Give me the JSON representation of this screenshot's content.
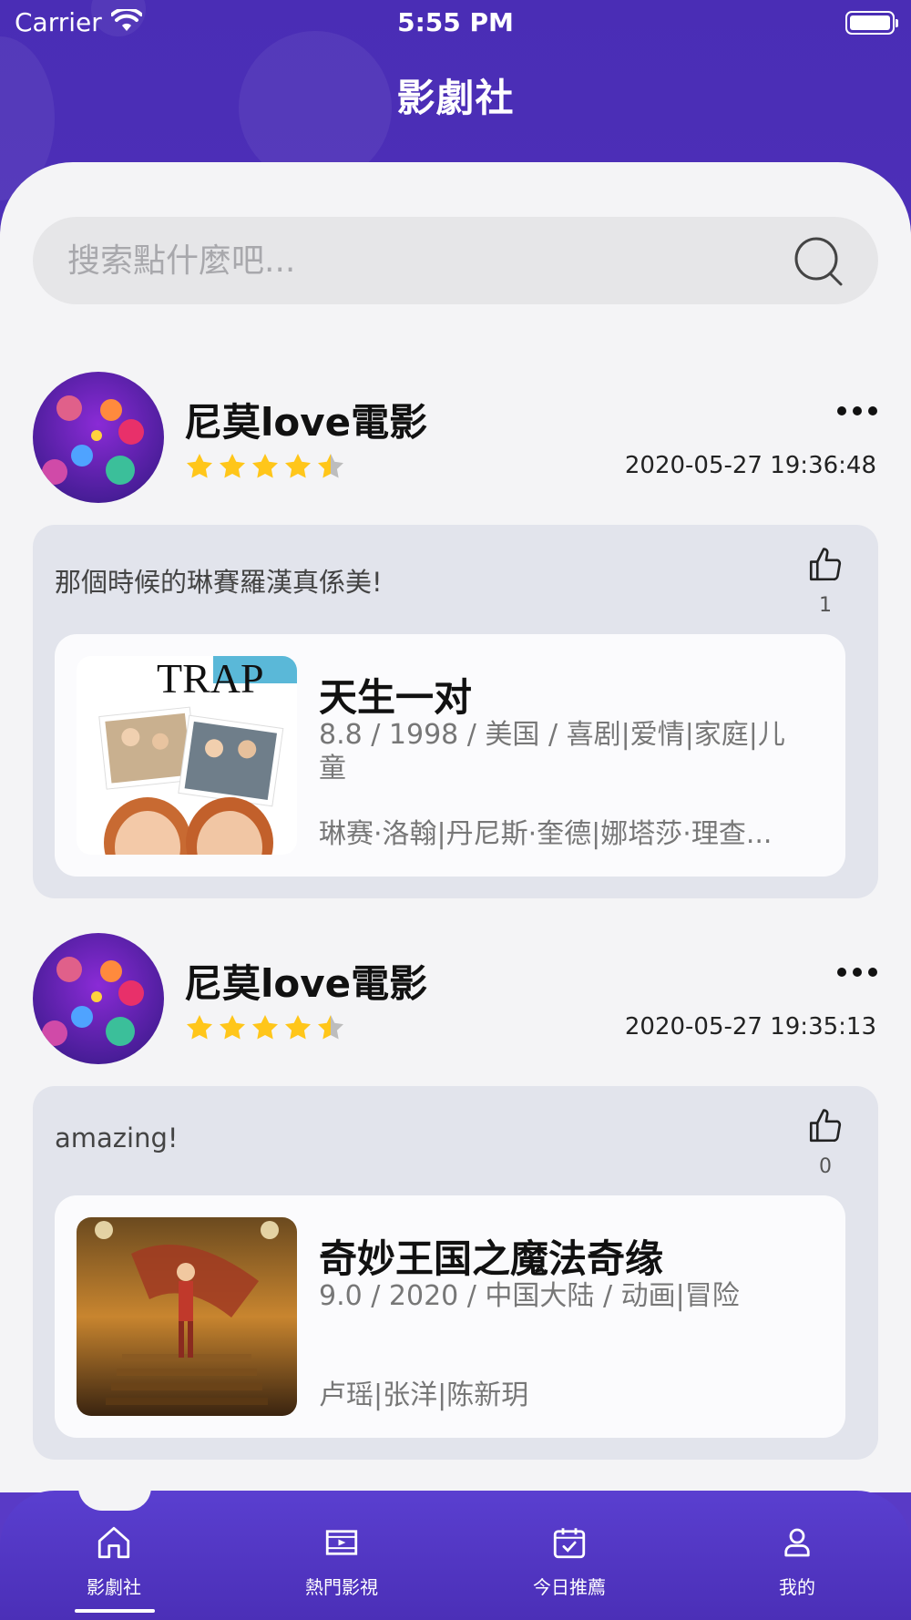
{
  "status_bar": {
    "carrier": "Carrier",
    "time": "5:55 PM"
  },
  "header": {
    "title": "影劇社"
  },
  "search": {
    "placeholder": "搜索點什麼吧..."
  },
  "posts": [
    {
      "username": "尼莫love電影",
      "rating": 4.5,
      "timestamp": "2020-05-27 19:36:48",
      "comment": "那個時候的琳賽羅漢真係美!",
      "likes": "1",
      "movie": {
        "title": "天生一对",
        "meta": "8.8 / 1998 / 美国 / 喜剧|爱情|家庭|儿童",
        "cast": "琳赛·洛翰|丹尼斯·奎德|娜塔莎·理查...",
        "poster_text": "TRAP"
      }
    },
    {
      "username": "尼莫love電影",
      "rating": 4.5,
      "timestamp": "2020-05-27 19:35:13",
      "comment": "amazing!",
      "likes": "0",
      "movie": {
        "title": "奇妙王国之魔法奇缘",
        "meta": "9.0 / 2020 / 中国大陆 / 动画|冒险",
        "cast": "卢瑶|张洋|陈新玥"
      }
    }
  ],
  "tabbar": {
    "tabs": [
      {
        "label": "影劇社",
        "icon": "home-icon",
        "active": true
      },
      {
        "label": "熱門影視",
        "icon": "video-icon",
        "active": false
      },
      {
        "label": "今日推薦",
        "icon": "calendar-icon",
        "active": false
      },
      {
        "label": "我的",
        "icon": "user-icon",
        "active": false
      }
    ]
  },
  "colors": {
    "primary": "#4a2db5",
    "background": "#f4f4f6",
    "card": "#e2e4ec",
    "star": "#ffc61a"
  }
}
